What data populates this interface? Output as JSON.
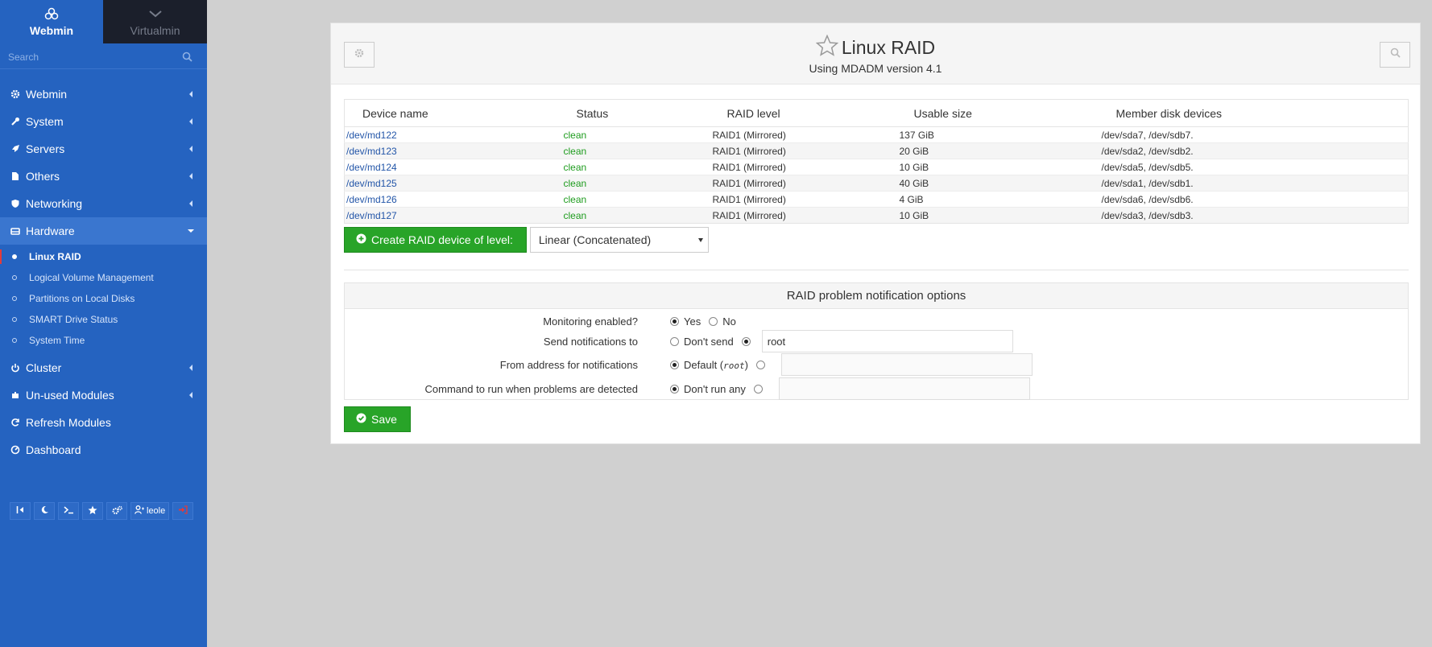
{
  "sidebar": {
    "tabs": [
      {
        "label": "Webmin"
      },
      {
        "label": "Virtualmin"
      }
    ],
    "search_placeholder": "Search",
    "menu": [
      {
        "label": "Webmin",
        "icon": "gear-icon"
      },
      {
        "label": "System",
        "icon": "wrench-icon"
      },
      {
        "label": "Servers",
        "icon": "rocket-icon"
      },
      {
        "label": "Others",
        "icon": "file-icon"
      },
      {
        "label": "Networking",
        "icon": "shield-icon"
      },
      {
        "label": "Hardware",
        "icon": "hdd-icon"
      }
    ],
    "hardware_sub": [
      "Linux RAID",
      "Logical Volume Management",
      "Partitions on Local Disks",
      "SMART Drive Status",
      "System Time"
    ],
    "menu_after": [
      {
        "label": "Cluster",
        "icon": "power-icon"
      },
      {
        "label": "Un-used Modules",
        "icon": "puzzle-icon"
      },
      {
        "label": "Refresh Modules",
        "icon": "refresh-icon"
      },
      {
        "label": "Dashboard",
        "icon": "dashboard-icon"
      }
    ],
    "user": "leole"
  },
  "header": {
    "title": "Linux RAID",
    "subtitle": "Using MDADM version 4.1"
  },
  "table": {
    "columns": [
      "Device name",
      "Status",
      "RAID level",
      "Usable size",
      "Member disk devices"
    ],
    "rows": [
      [
        "/dev/md122",
        "clean",
        "RAID1 (Mirrored)",
        "137 GiB",
        "/dev/sda7, /dev/sdb7."
      ],
      [
        "/dev/md123",
        "clean",
        "RAID1 (Mirrored)",
        "20 GiB",
        "/dev/sda2, /dev/sdb2."
      ],
      [
        "/dev/md124",
        "clean",
        "RAID1 (Mirrored)",
        "10 GiB",
        "/dev/sda5, /dev/sdb5."
      ],
      [
        "/dev/md125",
        "clean",
        "RAID1 (Mirrored)",
        "40 GiB",
        "/dev/sda1, /dev/sdb1."
      ],
      [
        "/dev/md126",
        "clean",
        "RAID1 (Mirrored)",
        "4 GiB",
        "/dev/sda6, /dev/sdb6."
      ],
      [
        "/dev/md127",
        "clean",
        "RAID1 (Mirrored)",
        "10 GiB",
        "/dev/sda3, /dev/sdb3."
      ]
    ]
  },
  "create": {
    "button_label": "Create RAID device of level:",
    "selected_level": "Linear (Concatenated)"
  },
  "notify": {
    "title": "RAID problem notification options",
    "monitoring_label": "Monitoring enabled?",
    "monitoring_yes": "Yes",
    "monitoring_no": "No",
    "send_label": "Send notifications to",
    "send_dont": "Don't send",
    "send_value": "root",
    "from_label": "From address for notifications",
    "from_default": "Default (",
    "from_default_user": "root",
    "from_default_close": ")",
    "from_value": "",
    "cmd_label": "Command to run when problems are detected",
    "cmd_dont": "Don't run any",
    "cmd_value": ""
  },
  "save_label": "Save",
  "colors": {
    "sidebar": "#2563c0",
    "green": "#28a428",
    "link": "#2255a8"
  }
}
